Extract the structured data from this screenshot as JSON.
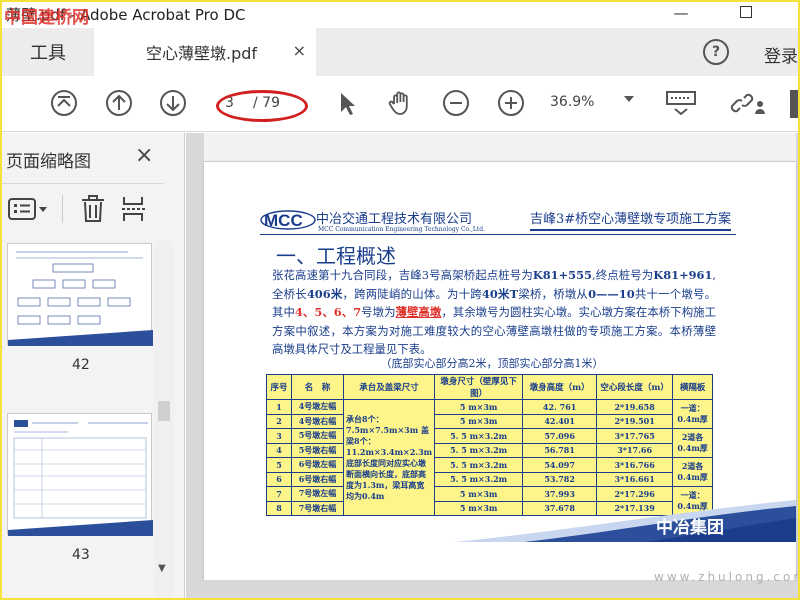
{
  "window": {
    "title": "薄壁.pdf - Adobe Acrobat Pro DC",
    "watermark": "中国建桥网"
  },
  "tabs": {
    "tools_label": "工具",
    "doc_label": "空心薄壁墩.pdf",
    "close_glyph": "×",
    "login_label": "登录"
  },
  "toolbar": {
    "current_page": "3",
    "total_pages": "/ 79",
    "zoom_value": "36.9%"
  },
  "left_panel": {
    "title": "页面缩略图",
    "close_glyph": "×",
    "thumbnails": [
      {
        "label": "42"
      },
      {
        "label": "43"
      }
    ]
  },
  "document": {
    "company_cn": "中冶交通工程技术有限公司",
    "company_en": "MCC Communication Engineering Technology  Co.,Ltd.",
    "header_right": "吉峰3#桥空心薄壁墩专项施工方案",
    "section_title": "一、工程概述",
    "para_1": "张花高速第十九合同段，吉峰3号高架桥起点桩号为",
    "start_stake": "K81+555",
    "para_2": ",终点桩号为",
    "end_stake": "K81+961",
    "para_3": ",全桥长",
    "length": "406米",
    "para_4": "，跨两陡峭的山体。为十跨",
    "span": "40米T",
    "para_5": "梁桥，桥墩从",
    "pier_range": "0——10",
    "para_6": "共十一个墩号。其中",
    "pier_ids": "4、5、6、7",
    "para_7": "号墩为",
    "pier_type": "薄壁高墩",
    "para_8": "，其余墩号为圆柱实心墩。实心墩方案在本桥下构施工方案中叙述，本方案为对施工难度较大的空心薄壁高墩柱做的专项施工方案。本桥薄壁高墩具体尺寸及工程量见下表。",
    "caption": "（底部实心部分高2米，顶部实心部分高1米）",
    "brand": "中冶集团",
    "table": {
      "headers": [
        "序号",
        "名　称",
        "承台及盖梁尺寸",
        "墩身尺寸（壁厚见下图）",
        "墩身高度（m）",
        "空心段长度（m）",
        "横隔板"
      ],
      "merged_size": "承台8个：7.5m×7.5m×3m 盖梁8个：11.2m×3.4m×2.3m 底部长度同对应实心墩断面横向长度，底部高度为1.3m，梁耳高宽均为0.4m",
      "rows": [
        {
          "no": "1",
          "name": "4号墩左幅",
          "size": "5 m×3m",
          "height": "42.  761",
          "hollow": "2*19.658"
        },
        {
          "no": "2",
          "name": "4号墩右幅",
          "size": "5 m×3m",
          "height": "42.401",
          "hollow": "2*19.501"
        },
        {
          "no": "3",
          "name": "5号墩左幅",
          "size": "5.  5 m×3.2m",
          "height": "57.096",
          "hollow": "3*17.765"
        },
        {
          "no": "4",
          "name": "5号墩右幅",
          "size": "5.  5 m×3.2m",
          "height": "56.781",
          "hollow": "3*17.66"
        },
        {
          "no": "5",
          "name": "6号墩左幅",
          "size": "5.  5 m×3.2m",
          "height": "54.097",
          "hollow": "3*16.766"
        },
        {
          "no": "6",
          "name": "6号墩右幅",
          "size": "5.  5 m×3.2m",
          "height": "53.782",
          "hollow": "3*16.661"
        },
        {
          "no": "7",
          "name": "7号墩左幅",
          "size": "5 m×3m",
          "height": "37.993",
          "hollow": "2*17.296"
        },
        {
          "no": "8",
          "name": "7号墩右幅",
          "size": "5 m×3m",
          "height": "37.678",
          "hollow": "2*17.139"
        }
      ],
      "diaphragms": [
        "一道：0.4m厚",
        "2道各0.4m厚",
        "2道各0.4m厚",
        "一道：0.4m厚"
      ]
    }
  },
  "footer_watermark": "www.zhulong.com",
  "colors": {
    "accent_blue": "#1a3e8c",
    "highlight_red": "#e0312b",
    "table_fill": "#fdf58a",
    "annotation_red": "#d21f1f"
  }
}
